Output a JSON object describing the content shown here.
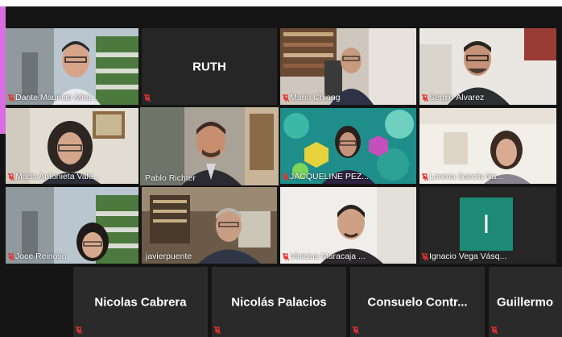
{
  "meeting": {
    "participants": [
      {
        "id": "p1",
        "name": "Dante Mauricio Mira...",
        "muted": true
      },
      {
        "id": "p2",
        "name": "RUTH",
        "muted": true
      },
      {
        "id": "p3",
        "name": "Mario Chiong",
        "muted": true
      },
      {
        "id": "p4",
        "name": "Sergio Álvarez",
        "muted": true
      },
      {
        "id": "p5",
        "name": "María Antonieta Vale...",
        "muted": true
      },
      {
        "id": "p6",
        "name": "Pablo Richter",
        "muted": false,
        "active_speaker": true
      },
      {
        "id": "p7",
        "name": "JACQUELINE PEZ...",
        "muted": true
      },
      {
        "id": "p8",
        "name": "Lorena García Na...",
        "muted": true
      },
      {
        "id": "p9",
        "name": "Joce Reinoso",
        "muted": true
      },
      {
        "id": "p10",
        "name": "javierpuente",
        "muted": false
      },
      {
        "id": "p11",
        "name": "Vinicius Maracaja ...",
        "muted": true
      },
      {
        "id": "p12",
        "name": "Ignacio Vega Vásq...",
        "muted": true,
        "avatar_initial": "I"
      },
      {
        "id": "p13",
        "name": "Nicolas Cabrera",
        "muted": true
      },
      {
        "id": "p14",
        "name": "Nicolás Palacios",
        "muted": true
      },
      {
        "id": "p15",
        "name": "Consuelo Contr...",
        "muted": true
      },
      {
        "id": "p16",
        "name": "Guillermo",
        "muted": true
      }
    ]
  },
  "colors": {
    "active_speaker_border": "#e8e65a",
    "muted_icon": "#e5322d",
    "avatar_bg": "#1c8a75",
    "side_strip": "#d96ee3"
  }
}
